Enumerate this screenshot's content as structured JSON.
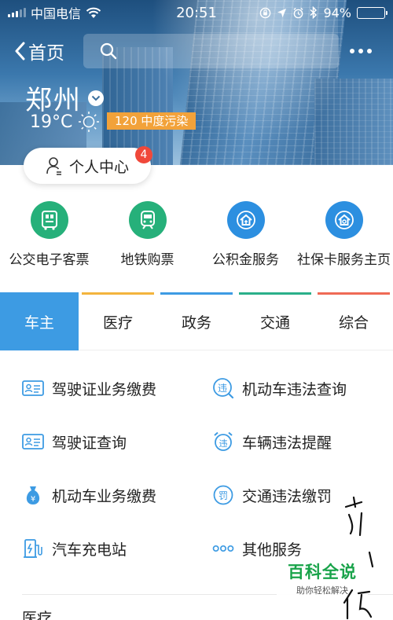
{
  "status_bar": {
    "carrier": "中国电信",
    "time": "20:51",
    "battery": "94%",
    "battery_level": 0.94
  },
  "nav": {
    "back_label": "首页"
  },
  "city": {
    "name": "郑州",
    "temperature": "19°C",
    "pollution": "120 中度污染"
  },
  "user_center": {
    "label": "个人中心",
    "badge": "4"
  },
  "quick_services": [
    {
      "label": "公交电子客票",
      "icon": "bus-ticket-icon",
      "color": "#26b07a"
    },
    {
      "label": "地铁购票",
      "icon": "metro-icon",
      "color": "#26b07a"
    },
    {
      "label": "公积金服务",
      "icon": "housing-fund-icon",
      "color": "#2c8fe0"
    },
    {
      "label": "社保卡服务主页",
      "icon": "social-security-icon",
      "color": "#2c8fe0"
    }
  ],
  "tabs": [
    {
      "label": "车主",
      "active": true,
      "color": "#3d9be3"
    },
    {
      "label": "医疗",
      "active": false,
      "color": "#f3b43d"
    },
    {
      "label": "政务",
      "active": false,
      "color": "#3d9be3"
    },
    {
      "label": "交通",
      "active": false,
      "color": "#2bb08a"
    },
    {
      "label": "综合",
      "active": false,
      "color": "#ef6a55"
    }
  ],
  "services": [
    {
      "label": "驾驶证业务缴费",
      "icon": "id-card-icon"
    },
    {
      "label": "机动车违法查询",
      "icon": "violation-search-icon"
    },
    {
      "label": "驾驶证查询",
      "icon": "id-card-icon"
    },
    {
      "label": "车辆违法提醒",
      "icon": "alarm-icon"
    },
    {
      "label": "机动车业务缴费",
      "icon": "money-bag-icon"
    },
    {
      "label": "交通违法缴罚",
      "icon": "fine-icon"
    },
    {
      "label": "汽车充电站",
      "icon": "charging-station-icon"
    },
    {
      "label": "其他服务",
      "icon": "more-dots-icon"
    }
  ],
  "next_section": "医疗",
  "watermark": {
    "title": "百科全说",
    "subtitle": "助你轻松解决"
  }
}
